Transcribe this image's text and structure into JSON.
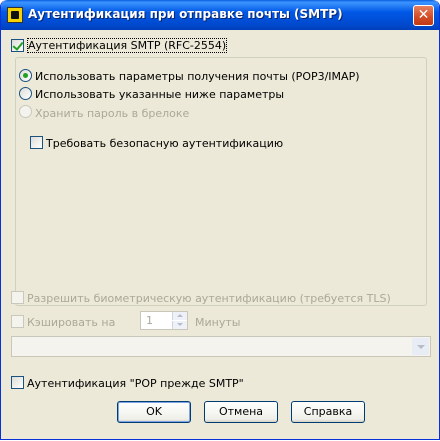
{
  "window": {
    "title": "Аутентификация при отправке почты (SMTP)",
    "close_glyph": "✕",
    "icon": "app-icon"
  },
  "smtp_auth": {
    "label": "Аутентификация SMTP (RFC-2554)",
    "checked": true
  },
  "options": {
    "use_receive_settings": "Использовать параметры получения почты (POP3/IMAP)",
    "use_below_settings": "Использовать указанные ниже параметры",
    "store_password": "Хранить пароль в брелоке",
    "require_secure": "Требовать безопасную аутентификацию"
  },
  "biometric": {
    "label": "Разрешить биометрическую аутентификацию (требуется TLS)"
  },
  "cache": {
    "label": "Кэшировать на",
    "value": "1",
    "unit": "Минуты"
  },
  "combo": {
    "value": ""
  },
  "pop_before_smtp": {
    "label": "Аутентификация \"POP прежде SMTP\"",
    "checked": false
  },
  "buttons": {
    "ok": "OK",
    "cancel": "Отмена",
    "help": "Справка"
  },
  "colors": {
    "titlebar": "#0058e6",
    "dialog_bg": "#ece9d8",
    "check_green": "#21a121",
    "disabled_text": "#aca899"
  }
}
